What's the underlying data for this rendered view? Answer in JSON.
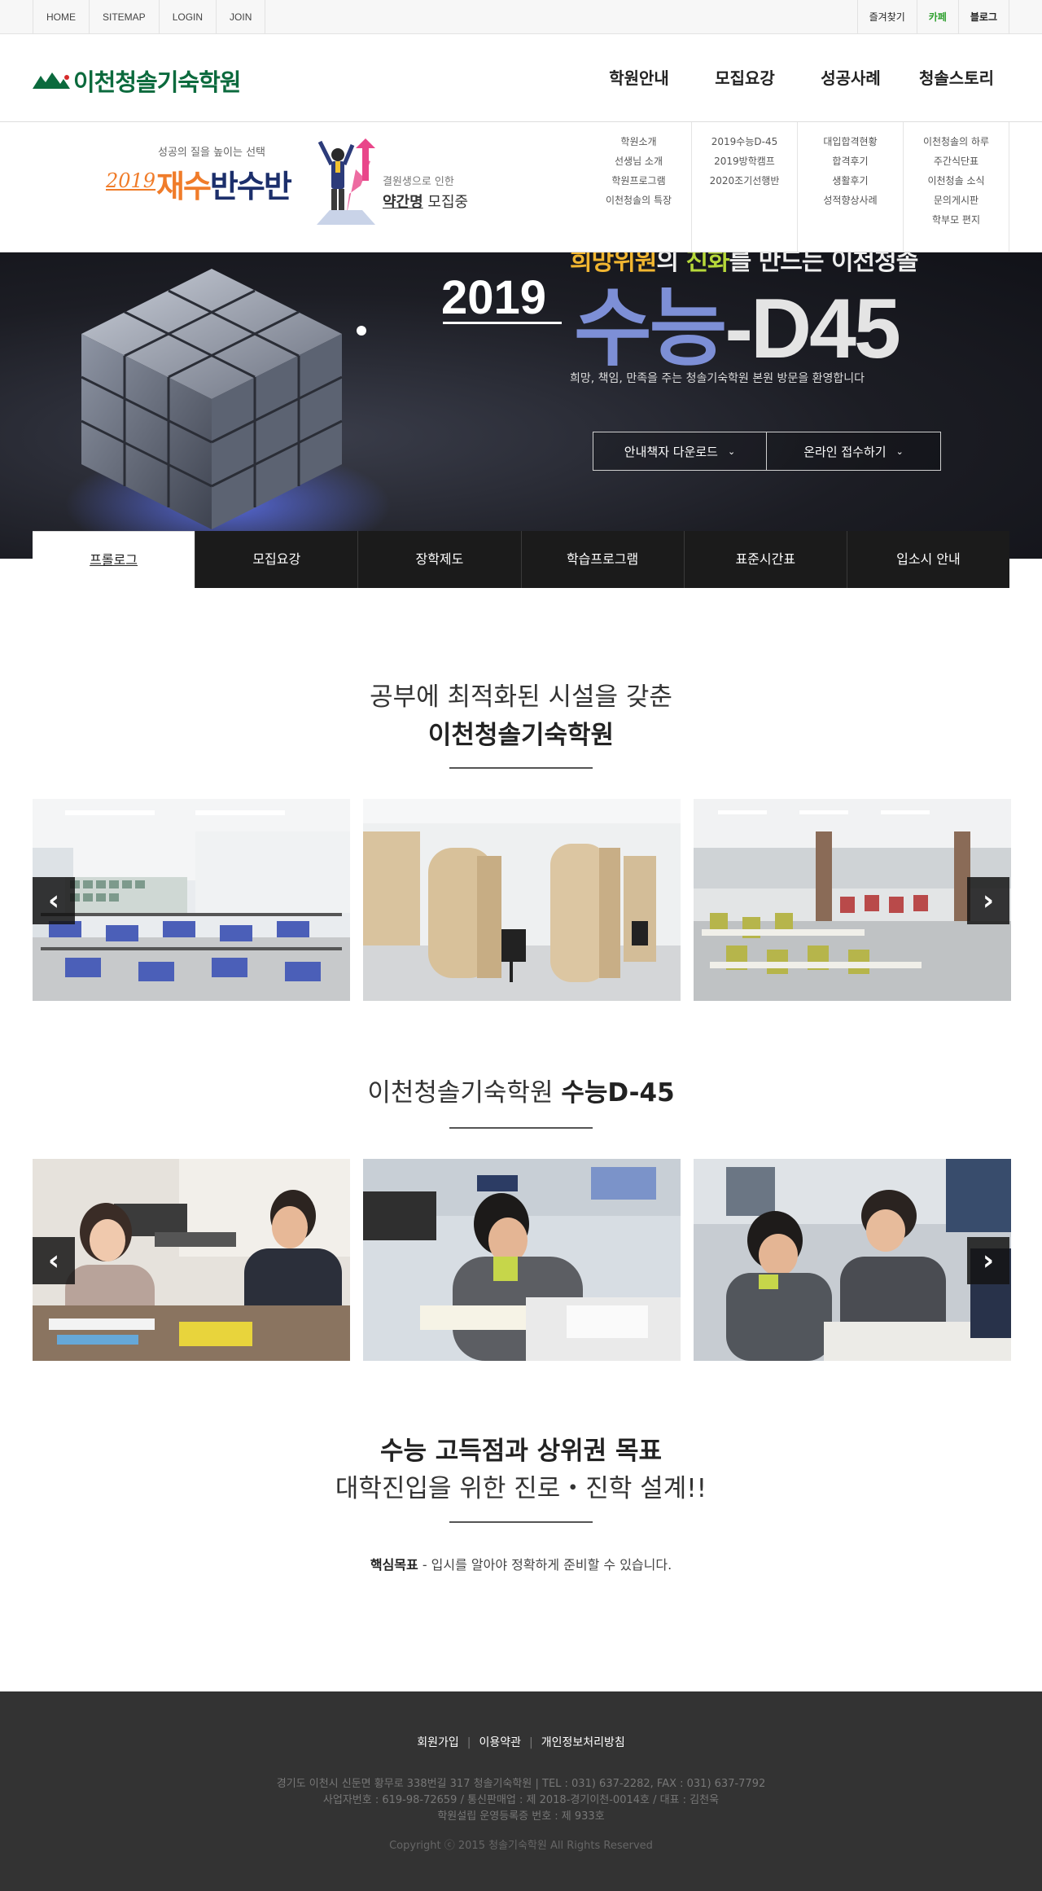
{
  "topbar": {
    "left_links": [
      "HOME",
      "SITEMAP",
      "LOGIN",
      "JOIN"
    ],
    "right_links": [
      "즐겨찾기",
      "카페",
      "블로그"
    ]
  },
  "header": {
    "logo_text": "이천청솔기숙학원",
    "nav": [
      "학원안내",
      "모집요강",
      "성공사례",
      "청솔스토리"
    ]
  },
  "submenu": {
    "promo": {
      "subtitle": "성공의 질을 높이는 선택",
      "year": "2019",
      "title_orange": "재수",
      "title_navy": "반수반",
      "right_line1": "결원생으로 인한",
      "right_line2_bold": "약간명",
      "right_line2_rest": " 모집중"
    },
    "columns": [
      [
        "학원소개",
        "선생님 소개",
        "학원프로그램",
        "이천청솔의 특장"
      ],
      [
        "2019수능D-45",
        "2019방학캠프",
        "2020조기선행반"
      ],
      [
        "대입합격현황",
        "합격후기",
        "생활후기",
        "성적향상사례"
      ],
      [
        "이천청솔의 하루",
        "주간식단표",
        "이천청솔 소식",
        "문의게시판",
        "학부모 편지"
      ]
    ]
  },
  "hero": {
    "top_line_yellow": "희망위원",
    "top_line_mid": "의 ",
    "top_line_green": "진화",
    "top_line_rest": "를 만드는 이천청솔",
    "year": "2019",
    "title_a": "수능",
    "title_b": "-D45",
    "description": "희망, 책임, 만족을 주는 청솔기숙학원 본원 방문을 환영합니다",
    "buttons": [
      "안내책자 다운로드",
      "온라인 접수하기"
    ]
  },
  "tabs": [
    "프롤로그",
    "모집요강",
    "장학제도",
    "학습프로그램",
    "표준시간표",
    "입소시 안내"
  ],
  "section1": {
    "line1": "공부에 최적화된 시설을 갖춘",
    "line2": "이천청솔기숙학원"
  },
  "section2": {
    "title_normal": "이천청솔기숙학원 ",
    "title_bold": "수능D-45"
  },
  "goal": {
    "line1": "수능 고득점과 상위권 목표",
    "line2": "대학진입을 위한 진로・진학 설계!!",
    "desc_bold": "핵심목표",
    "desc_rest": " - 입시를 알아야 정확하게 준비할 수 있습니다."
  },
  "footer": {
    "links": [
      "회원가입",
      "이용약관",
      "개인정보처리방침"
    ],
    "info1": "경기도 이천시 신둔면 황무로 338번길 317 청솔기숙학원  |  TEL : 031) 637-2282, FAX : 031) 637-7792",
    "info2": "사업자번호 : 619-98-72659 / 통신판매업 : 제 2018-경기이천-0014호 / 대표 : 김천욱",
    "info3": "학원설립 운영등록증 번호 : 제 933호",
    "copyright": "Copyright ⓒ 2015 청솔기숙학원 All Rights Reserved"
  },
  "colors": {
    "brand_green": "#0b6a3d",
    "accent_orange": "#f07c2a",
    "navy": "#1c2f6b",
    "hero_blue": "#7d8fd6",
    "footer_bg": "#333333",
    "tab_dark": "#1b1b1b"
  },
  "icons": [
    "mountain-logo-icon",
    "chevron-down-icon",
    "chevron-left-icon",
    "chevron-right-icon"
  ]
}
